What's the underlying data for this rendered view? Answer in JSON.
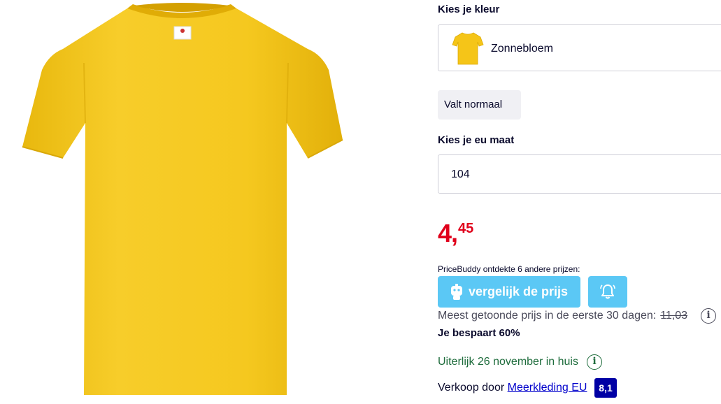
{
  "product": {
    "image_icon": "yellow-tshirt-image"
  },
  "color": {
    "heading": "Kies je kleur",
    "selected": "Zonnebloem",
    "swatch": "#f5c518"
  },
  "fit": {
    "label": "Valt normaal"
  },
  "size": {
    "heading": "Kies je eu maat",
    "selected": "104"
  },
  "price": {
    "integer": "4",
    "comma": ",",
    "decimals": "45",
    "color": "#e0001b"
  },
  "pricebuddy": {
    "text": "PriceBuddy ontdekte 6 andere prijzen:",
    "compare_label": "vergelijk de prijs",
    "button_color": "#5bc8f5",
    "bell_icon": "bell-icon"
  },
  "price_history": {
    "text": "Meest getoonde prijs in de eerste 30 dagen:",
    "old_price": "11,03"
  },
  "savings": {
    "text": "Je bespaart 60%"
  },
  "delivery": {
    "text": "Uiterlijk 26 november in huis",
    "color": "#1e6c3c"
  },
  "seller": {
    "prefix": "Verkoop door",
    "name": "Meerkleding EU",
    "rating": "8,1"
  },
  "info_symbol": "i"
}
